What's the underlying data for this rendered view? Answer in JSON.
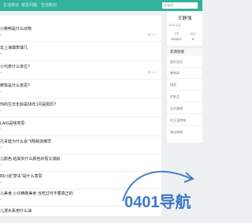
{
  "nav": {
    "items": [
      "生活常识",
      "常见问题",
      "生活知识"
    ],
    "search_placeholder": "关键词"
  },
  "posts": [
    {
      "title": "小黄鸭是什么动物",
      "stats": "14"
    },
    {
      "title": "去上海填表填几",
      "stats": ""
    },
    {
      "title": "小代表什么单位?",
      "stats": "16"
    },
    {
      "title": "摩靠是什么意思?",
      "stats": ""
    },
    {
      "title": "你的生日年龄是68年1月是阳历?",
      "stats": ""
    },
    {
      "title": "LAIG是啥意思",
      "stats": ""
    },
    {
      "title": "孔青蛙为什么会飞翔易逃稀罕",
      "stats": ""
    },
    {
      "title": "儿颜色,给其实什么颜色好看又减龄",
      "stats": ""
    },
    {
      "title": "四川话\"梦夫\"是什么意思",
      "stats": ""
    },
    {
      "title": "儿美食,小众精致美食 当吃过可不要真正的",
      "stats": ""
    },
    {
      "title": "儿漫水系用什么油",
      "stats": ""
    }
  ],
  "profile": {
    "name": "王静强",
    "subtitle": "SINA认证",
    "stat1_label": "文章",
    "stat1_value": "992822",
    "stat2_label": "阅读",
    "stat2_value": "8"
  },
  "links": {
    "heading": "友情链接",
    "items": [
      "国外发货",
      "教育网",
      "搜索",
      "护肤品",
      "佳木美城",
      "佳玉温商城",
      "珠宝商城"
    ]
  },
  "watermark": {
    "text": "0401导航",
    "brand_color": "#2a6cc0"
  }
}
